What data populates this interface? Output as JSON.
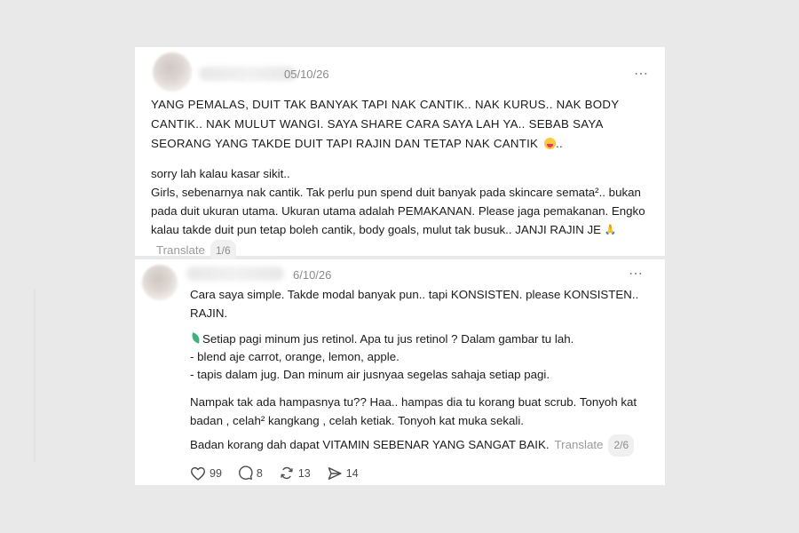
{
  "post1": {
    "date": "05/10/26",
    "more_icon": "⋯",
    "upper_text": "YANG PEMALAS, DUIT TAK BANYAK TAPI NAK CANTIK.. NAK KURUS.. NAK BODY CANTIK.. NAK MULUT WANGI. SAYA SHARE CARA SAYA LAH YA.. SEBAB SAYA SEORANG YANG TAKDE DUIT TAPI RAJIN DAN TETAP NAK CANTIK",
    "upper_tail": "..",
    "body_line1": "sorry lah kalau kasar sikit..",
    "body_line2": "Girls, sebenarnya nak cantik. Tak perlu pun spend duit banyak pada skincare semata².. bukan pada duit ukuran utama. Ukuran utama adalah PEMAKANAN. Please jaga pemakanan. Engko kalau takde duit pun tetap boleh cantik, body goals, mulut tak busuk.. JANJI RAJIN JE",
    "translate": "Translate",
    "page": "1/6"
  },
  "post2": {
    "date": "6/10/26",
    "more_icon": "⋯",
    "p1": "Cara saya simple. Takde modal banyak pun.. tapi KONSISTEN. please KONSISTEN.. RAJIN.",
    "p2_line1": "Setiap pagi minum jus retinol. Apa tu jus retinol ? Dalam gambar tu lah.",
    "p2_line2": "- blend aje carrot, orange, lemon, apple.",
    "p2_line3": "- tapis dalam jug. Dan minum air jusnyaa segelas sahaja setiap pagi.",
    "p3": "Nampak tak ada hampasnya tu?? Haa.. hampas dia tu korang buat scrub. Tonyoh kat badan , celah² kangkang , celah ketiak. Tonyoh kat muka sekali.",
    "p4": "Badan korang dah dapat VITAMIN SEBENAR YANG SANGAT BAIK.",
    "translate": "Translate",
    "page": "2/6"
  },
  "actions": {
    "likes": "99",
    "replies": "8",
    "reposts": "13",
    "shares": "14"
  },
  "icons": {
    "like": "heart-icon",
    "reply": "comment-bubble-icon",
    "repost": "repost-icon",
    "share": "send-icon",
    "more": "more-dots-icon"
  }
}
